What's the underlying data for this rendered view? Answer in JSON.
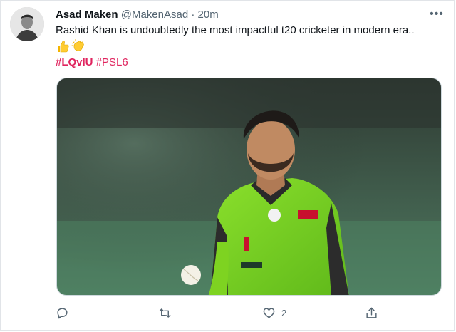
{
  "tweet": {
    "author_name": "Asad Maken",
    "handle": "@MakenAsad",
    "separator": "·",
    "time": "20m",
    "text": "Rashid Khan is undoubtedly the most impactful t20 cricketer in modern era..",
    "emojis": [
      "thumbs-up-icon",
      "clapping-hands-icon"
    ],
    "hashtags": [
      "#LQvIU",
      "#PSL6"
    ],
    "more_label": "•••",
    "media_alt": "Cricketer in green and black jersey looking down at a white ball"
  },
  "actions": {
    "reply_count": "",
    "retweet_count": "",
    "like_count": "2",
    "share_count": ""
  },
  "colors": {
    "hashtag": "#e0245e",
    "secondary_text": "#536471",
    "jersey_green": "#7ed321"
  }
}
